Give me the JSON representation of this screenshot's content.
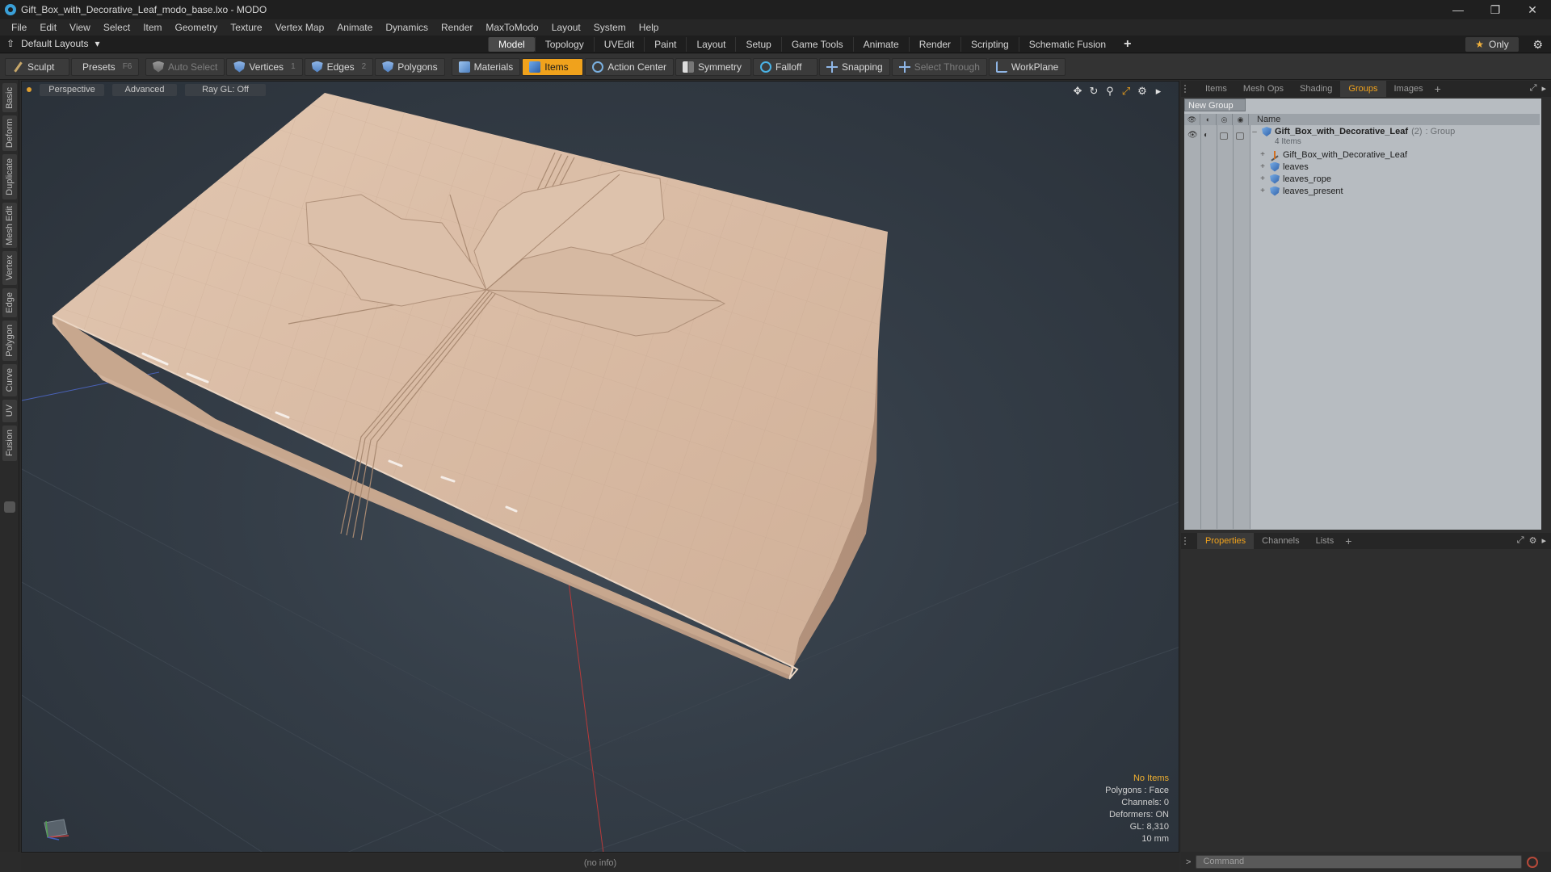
{
  "window": {
    "title": "Gift_Box_with_Decorative_Leaf_modo_base.lxo - MODO"
  },
  "menu": [
    "File",
    "Edit",
    "View",
    "Select",
    "Item",
    "Geometry",
    "Texture",
    "Vertex Map",
    "Animate",
    "Dynamics",
    "Render",
    "MaxToModo",
    "Layout",
    "System",
    "Help"
  ],
  "layoutbar": {
    "layout_select": "Default Layouts",
    "tabs": [
      "Model",
      "Topology",
      "UVEdit",
      "Paint",
      "Layout",
      "Setup",
      "Game Tools",
      "Animate",
      "Render",
      "Scripting",
      "Schematic Fusion"
    ],
    "active_tab": "Model",
    "only_label": "Only"
  },
  "toolbar": {
    "sculpt": "Sculpt",
    "presets": "Presets",
    "presets_key": "F6",
    "auto_select": "Auto Select",
    "vertices": "Vertices",
    "vertices_key": "1",
    "edges": "Edges",
    "edges_key": "2",
    "polygons": "Polygons",
    "materials": "Materials",
    "items": "Items",
    "action_center": "Action Center",
    "symmetry": "Symmetry",
    "falloff": "Falloff",
    "snapping": "Snapping",
    "select_through": "Select Through",
    "workplane": "WorkPlane"
  },
  "left_tabs": [
    "Basic",
    "Deform",
    "Duplicate",
    "Mesh Edit",
    "Vertex",
    "Edge",
    "Polygon",
    "Curve",
    "UV",
    "Fusion"
  ],
  "viewport": {
    "view_mode": "Perspective",
    "shading": "Advanced",
    "raygl": "Ray GL: Off",
    "info": {
      "no_items": "No Items",
      "polygons": "Polygons : Face",
      "channels": "Channels: 0",
      "deformers": "Deformers: ON",
      "gl": "GL: 8,310",
      "unit": "10 mm"
    }
  },
  "status": {
    "info": "(no info)"
  },
  "top_panel": {
    "tabs": [
      "Items",
      "Mesh Ops",
      "Shading",
      "Groups",
      "Images"
    ],
    "active_tab": "Groups",
    "new_group": "New Group",
    "column_name": "Name",
    "group": {
      "name": "Gift_Box_with_Decorative_Leaf",
      "count": "(2)",
      "type": ": Group",
      "sub": "4 Items"
    },
    "children": [
      "Gift_Box_with_Decorative_Leaf",
      "leaves",
      "leaves_rope",
      "leaves_present"
    ]
  },
  "bottom_panel": {
    "tabs": [
      "Properties",
      "Channels",
      "Lists"
    ],
    "active_tab": "Properties"
  },
  "command": {
    "placeholder": "Command"
  },
  "colors": {
    "accent": "#f0a21c",
    "info_highlight": "#f0b030"
  }
}
